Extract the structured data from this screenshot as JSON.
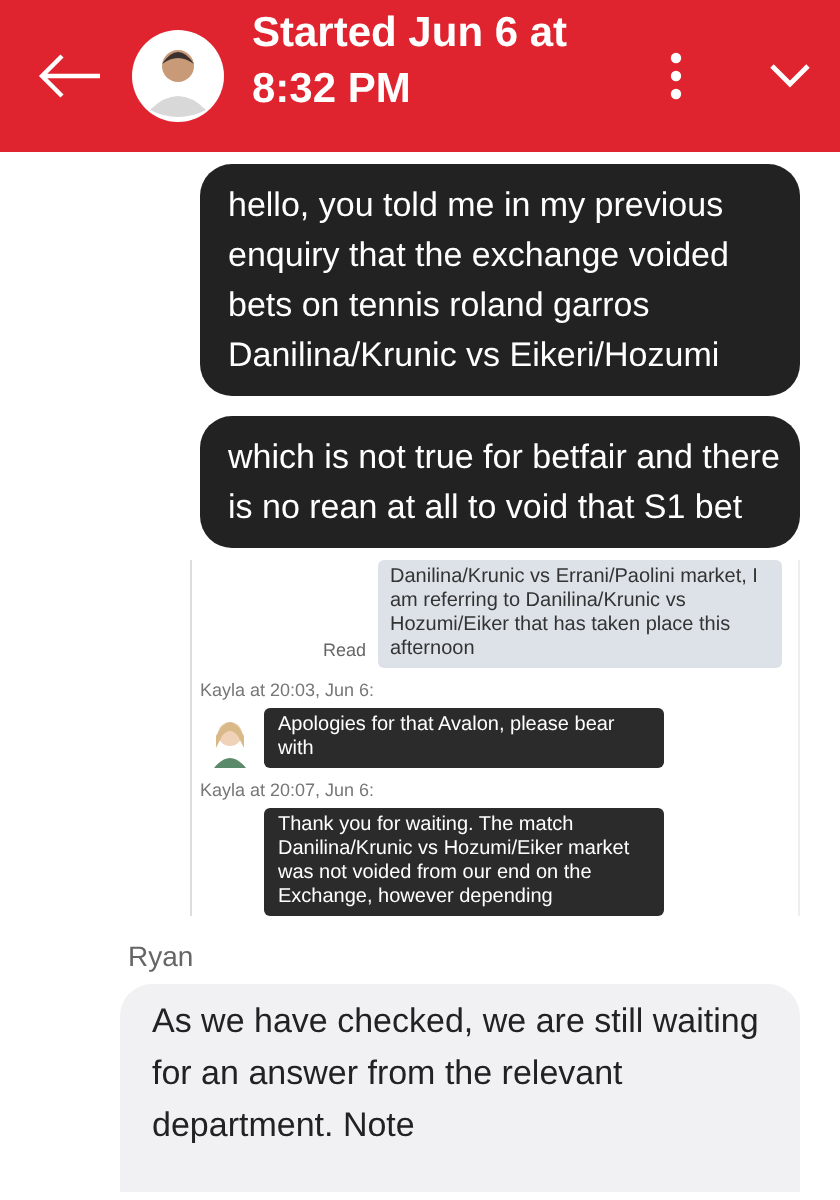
{
  "header": {
    "title": "Started Jun 6 at 8:32 PM"
  },
  "messages": [
    {
      "kind": "sent",
      "text": "hello, you told me in my previous enquiry that the exchange voided bets on tennis roland garros Danilina/Krunic vs Eikeri/Hozumi"
    },
    {
      "kind": "sent",
      "text": "which is not true for betfair and there is no rean at all to void that S1 bet"
    },
    {
      "kind": "attachment",
      "items": [
        {
          "kind": "own",
          "status": "Read",
          "text": "Danilina/Krunic vs Errani/Paolini market, I am referring to Danilina/Krunic vs Hozumi/Eiker that has taken place this afternoon"
        },
        {
          "kind": "meta",
          "text": "Kayla at 20:03, Jun 6:"
        },
        {
          "kind": "agent",
          "avatar": true,
          "text": "Apologies for that Avalon, please bear with"
        },
        {
          "kind": "meta",
          "text": "Kayla at 20:07, Jun 6:"
        },
        {
          "kind": "agent",
          "avatar": false,
          "text": "Thank you for waiting. The match Danilina/Krunic vs Hozumi/Eiker market was not voided from our end on the Exchange, however depending"
        }
      ]
    },
    {
      "kind": "sender",
      "text": "Ryan"
    },
    {
      "kind": "received",
      "text": "As we have checked, we are still waiting for an answer from the relevant department. Note"
    }
  ]
}
